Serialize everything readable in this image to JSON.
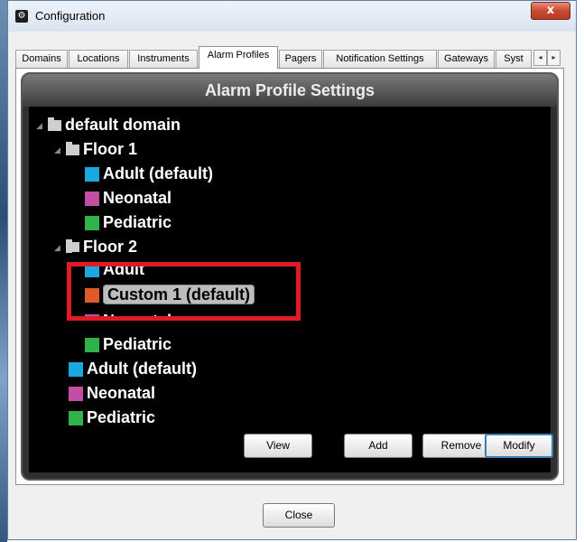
{
  "window": {
    "title": "Configuration",
    "close_glyph": "x",
    "app_icon_glyph": "⚙"
  },
  "tabs": [
    {
      "label": "Domains"
    },
    {
      "label": "Locations"
    },
    {
      "label": "Instruments"
    },
    {
      "label": "Alarm Profiles",
      "active": true
    },
    {
      "label": "Pagers"
    },
    {
      "label": "Notification Settings"
    },
    {
      "label": "Gateways"
    },
    {
      "label": "Syst"
    }
  ],
  "tab_scroll": {
    "left": "◂",
    "right": "▸"
  },
  "panel": {
    "header": "Alarm Profile Settings"
  },
  "colors": {
    "adult": "#1ba8e0",
    "neonatal": "#c24ea6",
    "pediatric": "#2fb34a",
    "custom": "#e05a28"
  },
  "tree": {
    "expander_glyph": "◢",
    "root": "default domain",
    "floor1": {
      "label": "Floor 1",
      "items": [
        "Adult (default)",
        "Neonatal",
        "Pediatric"
      ]
    },
    "floor2": {
      "label": "Floor 2",
      "items": [
        "Adult",
        "Custom 1 (default)",
        "Neonatal",
        "Pediatric"
      ],
      "selected": "Custom 1 (default)"
    },
    "domain_items": [
      "Adult (default)",
      "Neonatal",
      "Pediatric"
    ]
  },
  "buttons": {
    "view": "View",
    "add": "Add",
    "remove": "Remove",
    "modify": "Modify",
    "close": "Close"
  }
}
